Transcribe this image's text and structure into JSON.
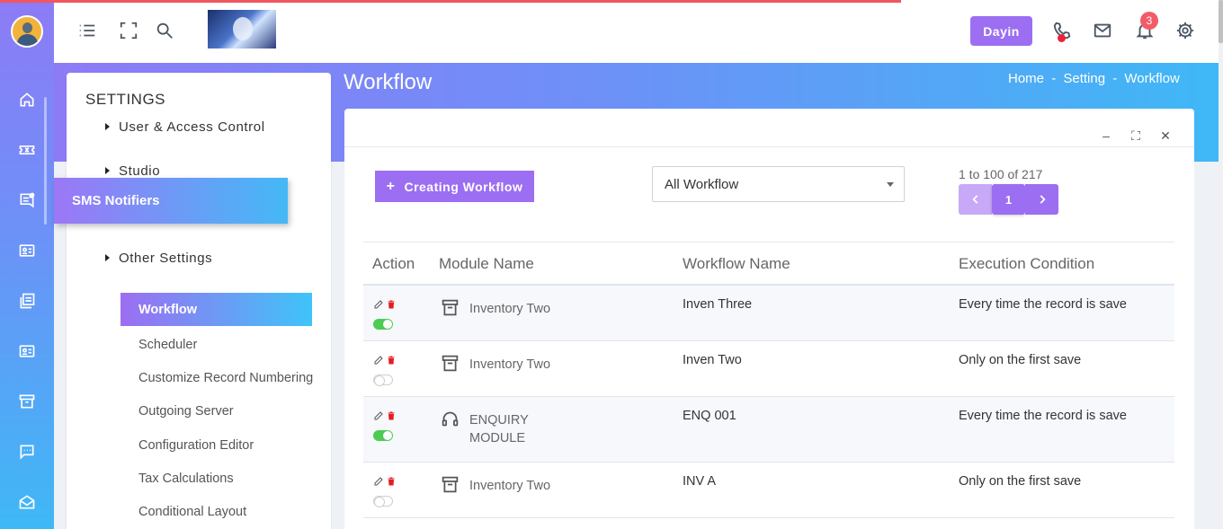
{
  "topbar": {
    "user_button": "Dayin",
    "notification_count": "3",
    "icons": [
      "menu-icon",
      "fullscreen-icon",
      "search-icon",
      "phone-icon",
      "mail-icon",
      "bell-icon",
      "gear-icon"
    ]
  },
  "rail": {
    "icons": [
      "home-icon",
      "ticket-icon",
      "sms-icon",
      "contact-card-icon",
      "documents-icon",
      "id-card-icon",
      "archive-icon",
      "chat-icon",
      "open-mail-icon"
    ]
  },
  "page": {
    "title": "Workflow",
    "breadcrumb": [
      "Home",
      "Setting",
      "Workflow"
    ],
    "breadcrumb_sep": "-"
  },
  "settings": {
    "heading": "SETTINGS",
    "groups": [
      "User & Access Control",
      "Studio",
      "Other Settings"
    ],
    "tooltip": "SMS Notifiers",
    "items": [
      "Workflow",
      "Scheduler",
      "Customize Record Numbering",
      "Outgoing Server",
      "Configuration Editor",
      "Tax Calculations",
      "Conditional Layout"
    ],
    "active_item": "Workflow"
  },
  "toolbar": {
    "create_label": "Creating Workflow",
    "filter_value": "All Workflow",
    "range_text": "1 to 100 of 217",
    "current_page": "1"
  },
  "window_controls": {
    "minimize": "–",
    "maximize": "⛶",
    "close": "✕"
  },
  "table": {
    "headers": [
      "Action",
      "Module Name",
      "Workflow Name",
      "Execution Condition"
    ],
    "rows": [
      {
        "module": "Inventory Two",
        "module_icon": "archive-icon",
        "workflow": "Inven Three",
        "condition": "Every time the record is save",
        "enabled": true
      },
      {
        "module": "Inventory Two",
        "module_icon": "archive-icon",
        "workflow": "Inven Two",
        "condition": "Only on the first save",
        "enabled": false
      },
      {
        "module": "ENQUIRY MODULE",
        "module_icon": "headset-icon",
        "workflow": "ENQ 001",
        "condition": "Every time the record is save",
        "enabled": true
      },
      {
        "module": "Inventory Two",
        "module_icon": "archive-icon",
        "workflow": "INV A",
        "condition": "Only on the first save",
        "enabled": false
      }
    ]
  },
  "colors": {
    "accent": "#9c6ef2",
    "gradient_start": "#8d7bf6",
    "gradient_end": "#3fb8f6",
    "toggle_on": "#4ccd52",
    "delete": "#e51c23"
  }
}
